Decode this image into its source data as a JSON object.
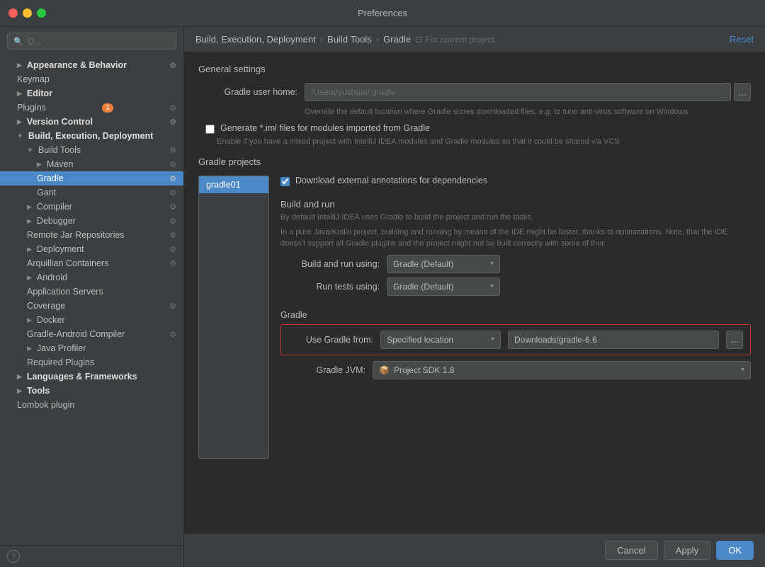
{
  "window": {
    "title": "Preferences"
  },
  "header": {
    "breadcrumb": [
      "Build, Execution, Deployment",
      "Build Tools",
      "Gradle"
    ],
    "project_label": "For current project",
    "reset_label": "Reset"
  },
  "sidebar": {
    "search_placeholder": "Q...",
    "items": [
      {
        "id": "appearance",
        "label": "Appearance & Behavior",
        "indent": 1,
        "arrow": "▶",
        "bold": true
      },
      {
        "id": "keymap",
        "label": "Keymap",
        "indent": 1,
        "bold": false
      },
      {
        "id": "editor",
        "label": "Editor",
        "indent": 1,
        "arrow": "▶",
        "bold": true
      },
      {
        "id": "plugins",
        "label": "Plugins",
        "indent": 1,
        "badge": "1",
        "bold": false
      },
      {
        "id": "version-control",
        "label": "Version Control",
        "indent": 1,
        "arrow": "▶",
        "bold": true
      },
      {
        "id": "build-execution",
        "label": "Build, Execution, Deployment",
        "indent": 1,
        "arrow": "▼",
        "bold": true
      },
      {
        "id": "build-tools",
        "label": "Build Tools",
        "indent": 2,
        "arrow": "▼",
        "bold": false
      },
      {
        "id": "maven",
        "label": "Maven",
        "indent": 3,
        "arrow": "▶",
        "bold": false
      },
      {
        "id": "gradle",
        "label": "Gradle",
        "indent": 3,
        "selected": true,
        "bold": false
      },
      {
        "id": "gant",
        "label": "Gant",
        "indent": 3,
        "bold": false
      },
      {
        "id": "compiler",
        "label": "Compiler",
        "indent": 2,
        "arrow": "▶",
        "bold": false
      },
      {
        "id": "debugger",
        "label": "Debugger",
        "indent": 2,
        "arrow": "▶",
        "bold": false
      },
      {
        "id": "remote-jar",
        "label": "Remote Jar Repositories",
        "indent": 2,
        "bold": false
      },
      {
        "id": "deployment",
        "label": "Deployment",
        "indent": 2,
        "arrow": "▶",
        "bold": false
      },
      {
        "id": "arquillian",
        "label": "Arquillian Containers",
        "indent": 2,
        "bold": false
      },
      {
        "id": "android",
        "label": "Android",
        "indent": 2,
        "arrow": "▶",
        "bold": false
      },
      {
        "id": "app-servers",
        "label": "Application Servers",
        "indent": 2,
        "bold": false
      },
      {
        "id": "coverage",
        "label": "Coverage",
        "indent": 2,
        "bold": false
      },
      {
        "id": "docker",
        "label": "Docker",
        "indent": 2,
        "arrow": "▶",
        "bold": false
      },
      {
        "id": "gradle-android",
        "label": "Gradle-Android Compiler",
        "indent": 2,
        "bold": false
      },
      {
        "id": "java-profiler",
        "label": "Java Profiler",
        "indent": 2,
        "arrow": "▶",
        "bold": false
      },
      {
        "id": "required-plugins",
        "label": "Required Plugins",
        "indent": 2,
        "bold": false
      },
      {
        "id": "languages",
        "label": "Languages & Frameworks",
        "indent": 1,
        "arrow": "▶",
        "bold": true
      },
      {
        "id": "tools",
        "label": "Tools",
        "indent": 1,
        "arrow": "▶",
        "bold": true
      },
      {
        "id": "lombok",
        "label": "Lombok plugin",
        "indent": 1,
        "bold": false
      }
    ]
  },
  "content": {
    "general_settings_title": "General settings",
    "gradle_user_home_label": "Gradle user home:",
    "gradle_user_home_value": "/Users/yushuai/.gradle",
    "gradle_user_home_hint": "Override the default location where Gradle stores downloaded files, e.g. to tune anti-virus software on Windows",
    "generate_iml_label": "Generate *.iml files for modules imported from Gradle",
    "generate_iml_hint": "Enable if you have a mixed project with IntelliJ IDEA modules and Gradle modules so that it could be shared via VCS",
    "gradle_projects_title": "Gradle projects",
    "project_item": "gradle01",
    "download_annotation_label": "Download external annotations for dependencies",
    "build_run_title": "Build and run",
    "build_run_hint1": "By default IntelliJ IDEA uses Gradle to build the project and run the tasks.",
    "build_run_hint2": "In a pure Java/Kotlin project, building and running by means of the IDE might be faster, thanks to optimizations. Note, that the IDE doesn't support all Gradle plugins and the project might not be built correctly with some of ther",
    "build_using_label": "Build and run using:",
    "build_using_value": "Gradle (Default)",
    "run_tests_label": "Run tests using:",
    "run_tests_value": "Gradle (Default)",
    "gradle_section_title": "Gradle",
    "use_gradle_label": "Use Gradle from:",
    "use_gradle_value": "Specified location",
    "gradle_path_value": "Downloads/gradle-6.6",
    "gradle_jvm_label": "Gradle JVM:",
    "gradle_jvm_value": "Project SDK 1.8"
  },
  "footer": {
    "cancel_label": "Cancel",
    "apply_label": "Apply",
    "ok_label": "OK"
  }
}
